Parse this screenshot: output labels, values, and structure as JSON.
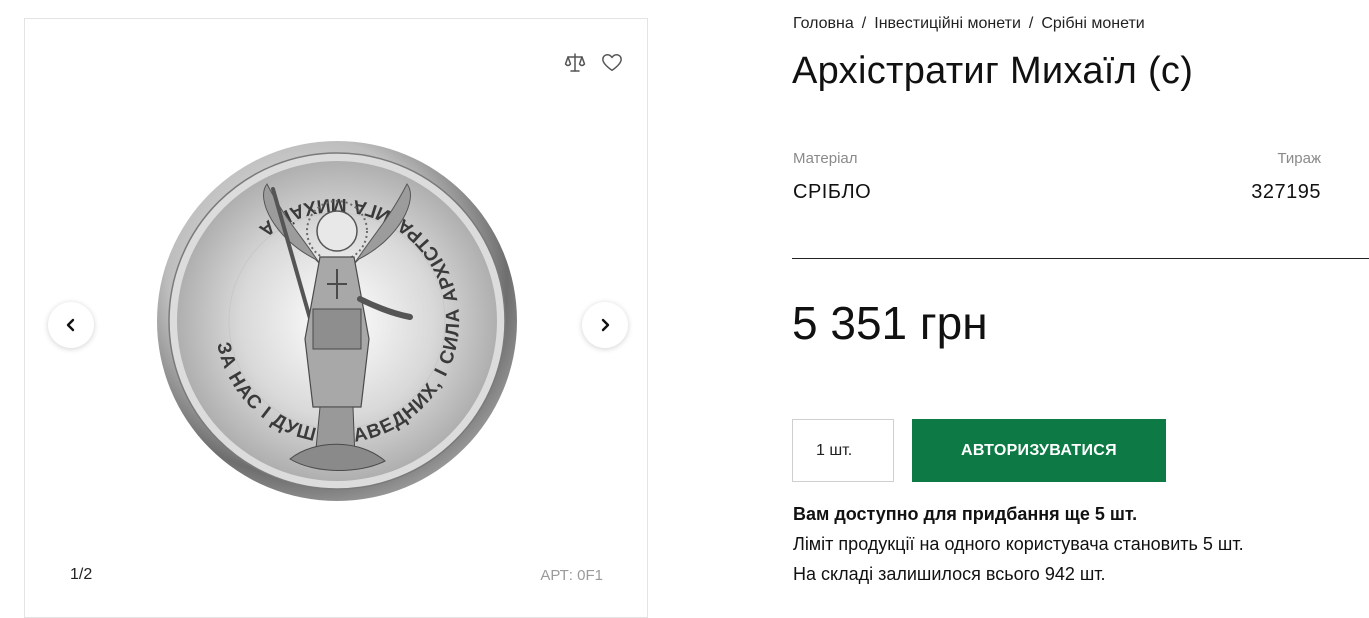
{
  "breadcrumb": {
    "items": [
      "Головна",
      "Інвестиційні монети",
      "Срібні монети"
    ],
    "separator": "/"
  },
  "product": {
    "title": "Архістратиг Михаїл (с)",
    "attributes": {
      "material_label": "Матеріал",
      "material_value": "СРІБЛО",
      "mintage_label": "Тираж",
      "mintage_value": "327195"
    },
    "price": "5 351 грн"
  },
  "gallery": {
    "counter": "1/2",
    "article": "АРТ: 0F1",
    "coin_inscription": "ЗА НАС І ДУШІ ПРАВЕДНИХ, І СИЛА АРХІСТРАТИГА МИХАЇЛА"
  },
  "purchase": {
    "quantity_value": "1 шт.",
    "button_label": "АВТОРИЗУВАТИСЯ"
  },
  "availability": {
    "line1": "Вам доступно для придбання ще 5 шт.",
    "line2": "Ліміт продукції на одного користувача становить 5 шт.",
    "line3": "На складі залишилося всього 942 шт."
  },
  "icons": {
    "compare": "scales-icon",
    "favorite": "heart-icon",
    "prev": "chevron-left-icon",
    "next": "chevron-right-icon"
  },
  "colors": {
    "accent": "#0d7a45",
    "text": "#111111",
    "muted": "#8a8a8a"
  }
}
